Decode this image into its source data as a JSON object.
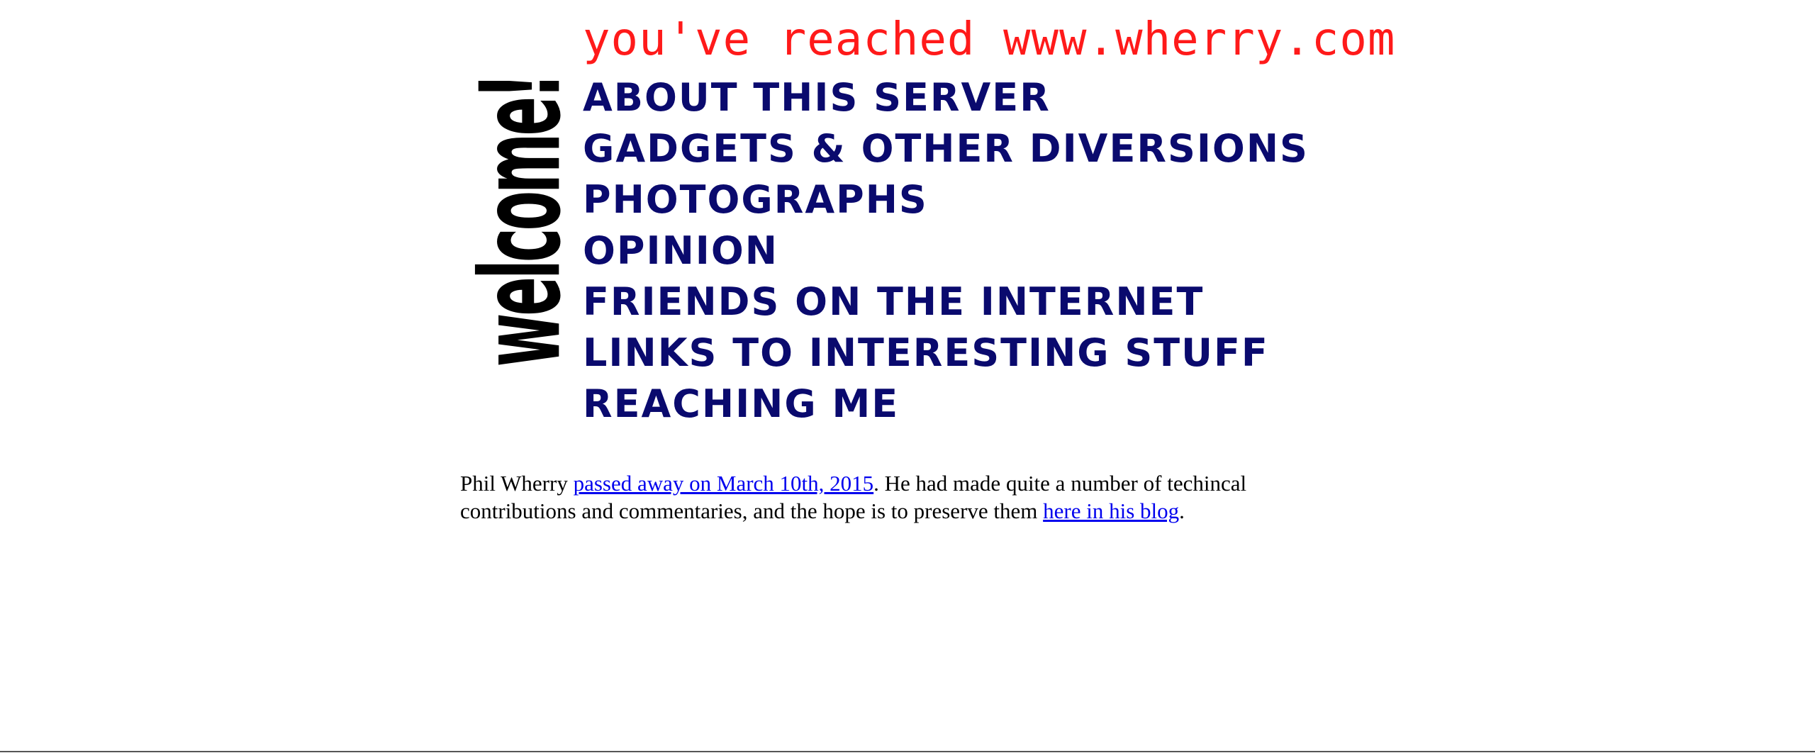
{
  "banner": {
    "welcome": "welcome!",
    "reached": "you've reached www.wherry.com",
    "menu": [
      "ABOUT THIS SERVER",
      "GADGETS & OTHER DIVERSIONS",
      "PHOTOGRAPHS",
      "OPINION",
      "FRIENDS ON THE INTERNET",
      "LINKS TO INTERESTING STUFF",
      "REACHING ME"
    ]
  },
  "note": {
    "t1": "Phil Wherry ",
    "link1": "passed away on March 10th, 2015",
    "t2": ". He had made quite a number of techincal contributions and commentaries, and the hope is to preserve them ",
    "link2": "here in his blog",
    "t3": "."
  },
  "colors": {
    "welcome": "#000000",
    "reached": "#ff1a1a",
    "menu": "#0a0a6e",
    "link": "#0000ee"
  }
}
